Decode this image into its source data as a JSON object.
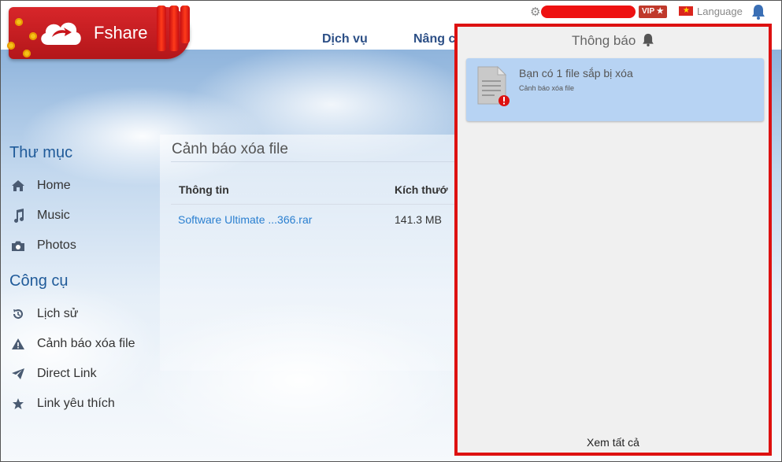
{
  "brand": {
    "name": "Fshare"
  },
  "nav": {
    "items": [
      {
        "label": "Dịch vụ"
      },
      {
        "label": "Nâng c"
      }
    ]
  },
  "status": {
    "vip_label": "VIP ★",
    "language_label": "Language"
  },
  "sidebar": {
    "sections": [
      {
        "title": "Thư mục",
        "items": [
          {
            "label": "Home",
            "icon": "home-icon"
          },
          {
            "label": "Music",
            "icon": "music-icon"
          },
          {
            "label": "Photos",
            "icon": "camera-icon"
          }
        ]
      },
      {
        "title": "Công cụ",
        "items": [
          {
            "label": "Lịch sử",
            "icon": "history-icon"
          },
          {
            "label": "Cảnh báo xóa file",
            "icon": "warning-icon"
          },
          {
            "label": "Direct Link",
            "icon": "send-icon"
          },
          {
            "label": "Link yêu thích",
            "icon": "star-icon"
          }
        ]
      }
    ]
  },
  "main": {
    "title": "Cảnh báo xóa file",
    "columns": [
      "Thông tin",
      "Kích thướ"
    ],
    "rows": [
      {
        "name": "Software Ultimate ...366.rar",
        "size": "141.3 MB"
      }
    ]
  },
  "notifications": {
    "title": "Thông báo",
    "items": [
      {
        "text": "Bạn có 1 file sắp bị xóa",
        "sub": "Cảnh báo xóa file"
      }
    ],
    "footer": "Xem tất cả"
  },
  "colors": {
    "accent": "#2c4f86",
    "link": "#2a7fd0",
    "alert": "#dd1111",
    "notif_item": "#b7d3f3"
  }
}
